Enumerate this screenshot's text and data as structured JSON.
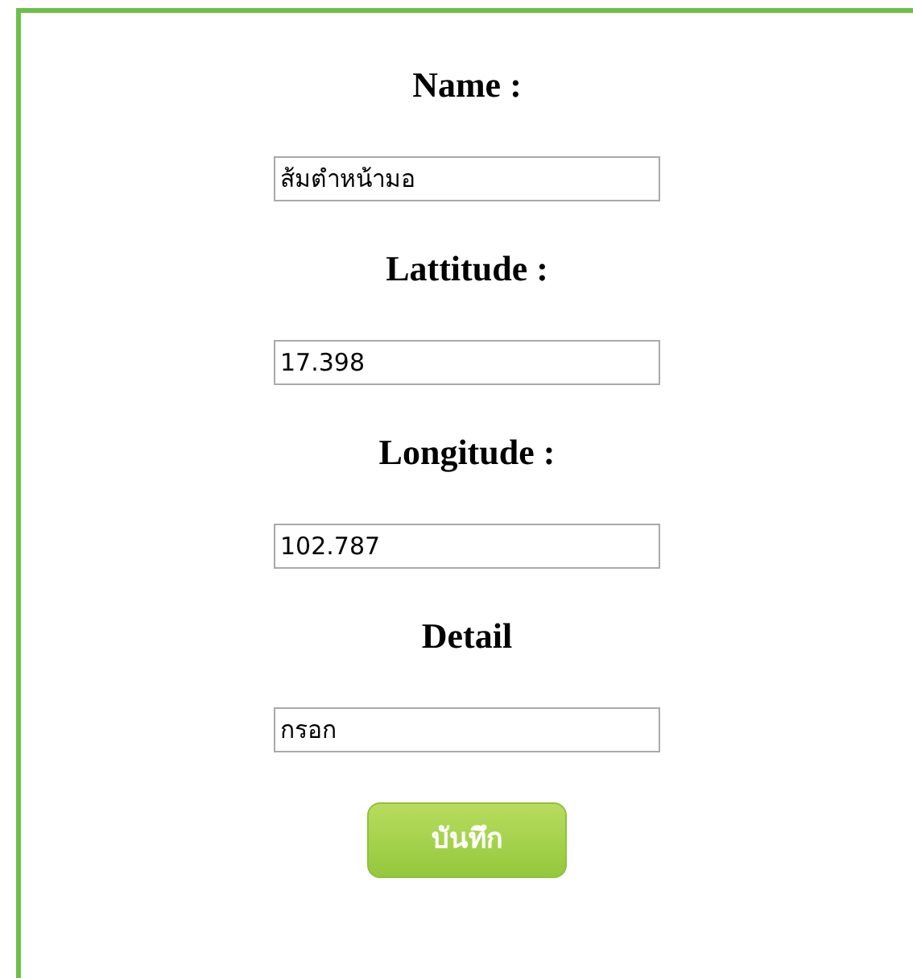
{
  "fields": [
    {
      "label": "Name :",
      "value": "ส้มตำหน้ามอ"
    },
    {
      "label": "Lattitude :",
      "value": "17.398"
    },
    {
      "label": "Longitude :",
      "value": "102.787"
    },
    {
      "label": "Detail",
      "value": "กรอก"
    }
  ],
  "submit_button": {
    "label": "บันทึก"
  }
}
